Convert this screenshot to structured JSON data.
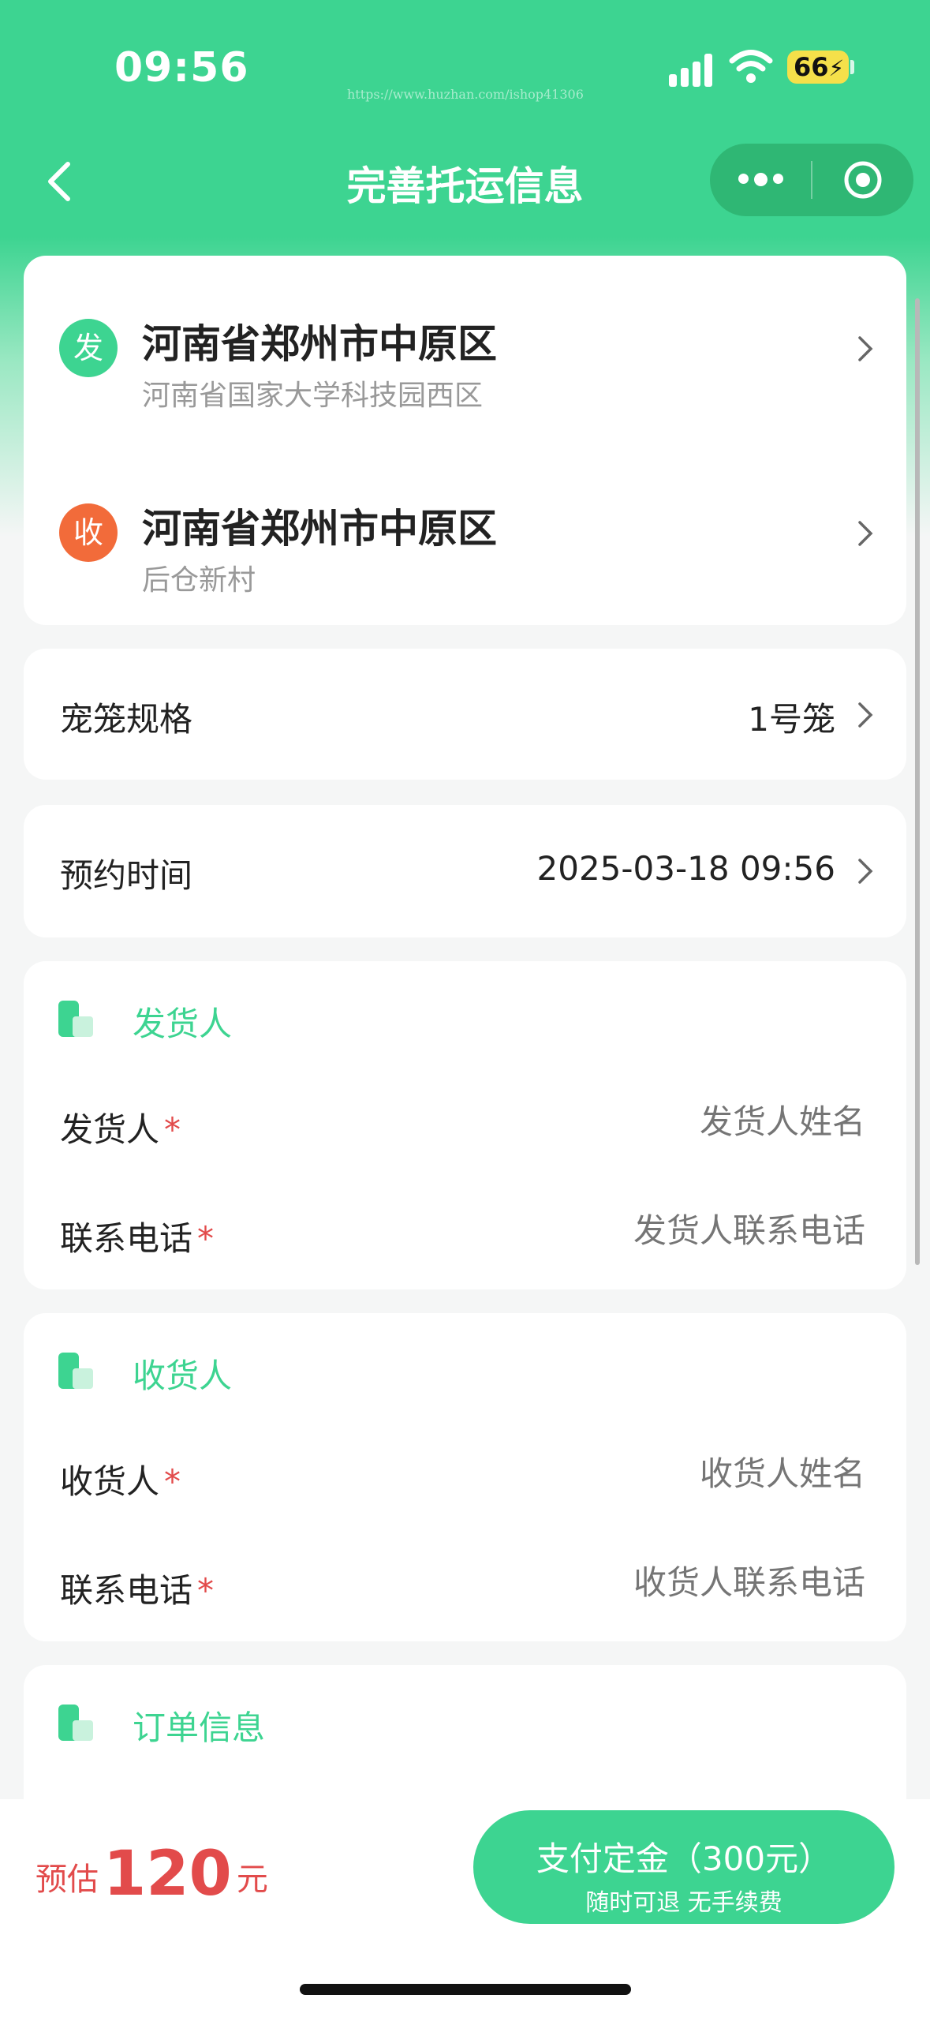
{
  "status": {
    "time": "09:56",
    "battery": "66",
    "watermark": "https://www.huzhan.com/ishop41306"
  },
  "nav": {
    "title": "完善托运信息"
  },
  "addresses": {
    "from": {
      "badge": "发",
      "title": "河南省郑州市中原区",
      "sub": "河南省国家大学科技园西区",
      "color": "#3dd491"
    },
    "to": {
      "badge": "收",
      "title": "河南省郑州市中原区",
      "sub": "后仓新村",
      "color": "#f26b3a"
    }
  },
  "cage": {
    "label": "宠笼规格",
    "value": "1号笼"
  },
  "appointment": {
    "label": "预约时间",
    "value": "2025-03-18 09:56"
  },
  "shipper": {
    "title": "发货人",
    "name_label": "发货人",
    "name_placeholder": "发货人姓名",
    "phone_label": "联系电话",
    "phone_placeholder": "发货人联系电话",
    "required": "*"
  },
  "receiver": {
    "title": "收货人",
    "name_label": "收货人",
    "name_placeholder": "收货人姓名",
    "phone_label": "联系电话",
    "phone_placeholder": "收货人联系电话",
    "required": "*"
  },
  "order": {
    "title": "订单信息"
  },
  "bottom": {
    "est_prefix": "预估",
    "est_amount": "120",
    "est_unit": "元",
    "pay_label": "支付定金（300元）",
    "pay_sub": "随时可退 无手续费"
  },
  "colors": {
    "accent": "#3dd491",
    "danger": "#e24b4b",
    "receive_badge": "#f26b3a"
  },
  "icons": {
    "back": "chevron-left-icon",
    "more": "more-dots-icon",
    "close": "target-circle-icon",
    "row": "chevron-right-icon"
  }
}
